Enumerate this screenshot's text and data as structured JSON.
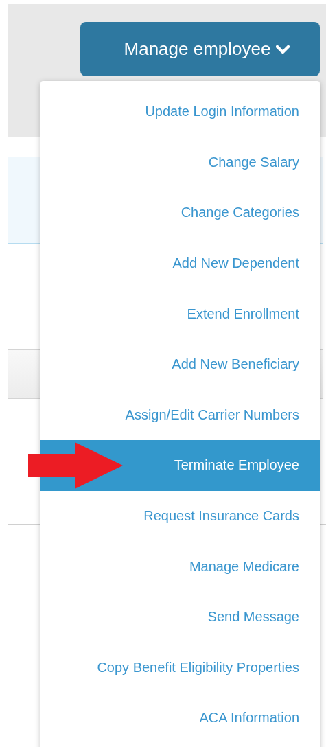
{
  "manage_button": {
    "label": "Manage employee",
    "expanded": true
  },
  "menu": {
    "items": [
      {
        "label": "Update Login Information",
        "selected": false
      },
      {
        "label": "Change Salary",
        "selected": false
      },
      {
        "label": "Change Categories",
        "selected": false
      },
      {
        "label": "Add New Dependent",
        "selected": false
      },
      {
        "label": "Extend Enrollment",
        "selected": false
      },
      {
        "label": "Add New Beneficiary",
        "selected": false
      },
      {
        "label": "Assign/Edit Carrier Numbers",
        "selected": false
      },
      {
        "label": "Terminate Employee",
        "selected": true
      },
      {
        "label": "Request Insurance Cards",
        "selected": false
      },
      {
        "label": "Manage Medicare",
        "selected": false
      },
      {
        "label": "Send Message",
        "selected": false
      },
      {
        "label": "Copy Benefit Eligibility Properties",
        "selected": false
      },
      {
        "label": "ACA Information",
        "selected": false
      }
    ]
  }
}
